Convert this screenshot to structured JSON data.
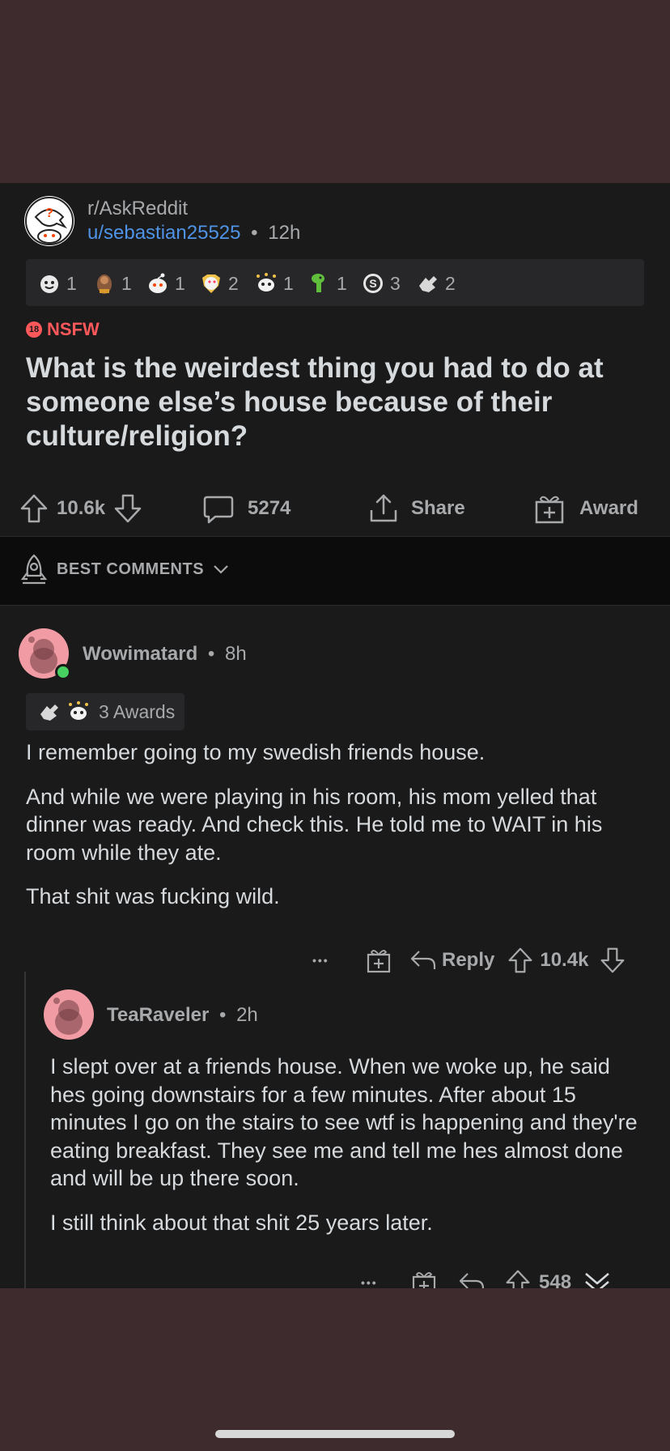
{
  "post": {
    "subreddit": "r/AskReddit",
    "author": "u/sebastian25525",
    "separator": "•",
    "age": "12h",
    "awards": [
      {
        "icon": "wholesome-award-icon",
        "count": "1"
      },
      {
        "icon": "bravo-award-icon",
        "count": "1"
      },
      {
        "icon": "snoo-award-icon",
        "count": "1"
      },
      {
        "icon": "heart-eyes-award-icon",
        "count": "2"
      },
      {
        "icon": "party-award-icon",
        "count": "1"
      },
      {
        "icon": "dino-award-icon",
        "count": "1"
      },
      {
        "icon": "silver-award-icon",
        "count": "3"
      },
      {
        "icon": "helpful-award-icon",
        "count": "2"
      }
    ],
    "nsfw_badge": "18",
    "nsfw_label": "NSFW",
    "title": "What is the weirdest thing you had to do at someone else’s house because of their culture/religion?",
    "score": "10.6k",
    "comment_count": "5274",
    "share_label": "Share",
    "award_label": "Award"
  },
  "sort": {
    "label": "BEST COMMENTS"
  },
  "comments": [
    {
      "author": "Wowimatard",
      "age": "8h",
      "awards_label": "3 Awards",
      "paragraphs": [
        "I remember going to my swedish friends house.",
        "And while we were playing in his room, his mom yelled that dinner was ready. And check this. He told me to WAIT in his room while they ate.",
        "That shit was fucking wild."
      ],
      "more": "•••",
      "reply_label": "Reply",
      "score": "10.4k"
    },
    {
      "author": "TeaRaveler",
      "age": "2h",
      "paragraphs": [
        "I slept over at a friends house. When we woke up, he said hes going downstairs for a few minutes. After about 15 minutes I go on the stairs to see wtf is happening and they're eating breakfast. They see me and tell me hes almost done and will be up there soon.",
        "I still think about that shit 25 years later."
      ],
      "more": "•••",
      "score": "548"
    }
  ],
  "colors": {
    "outer_bg": "#3d2b2e",
    "panel_bg": "#1a1a1b",
    "link_blue": "#4f93e6",
    "nsfw_red": "#ff585b",
    "online_green": "#46d160"
  }
}
